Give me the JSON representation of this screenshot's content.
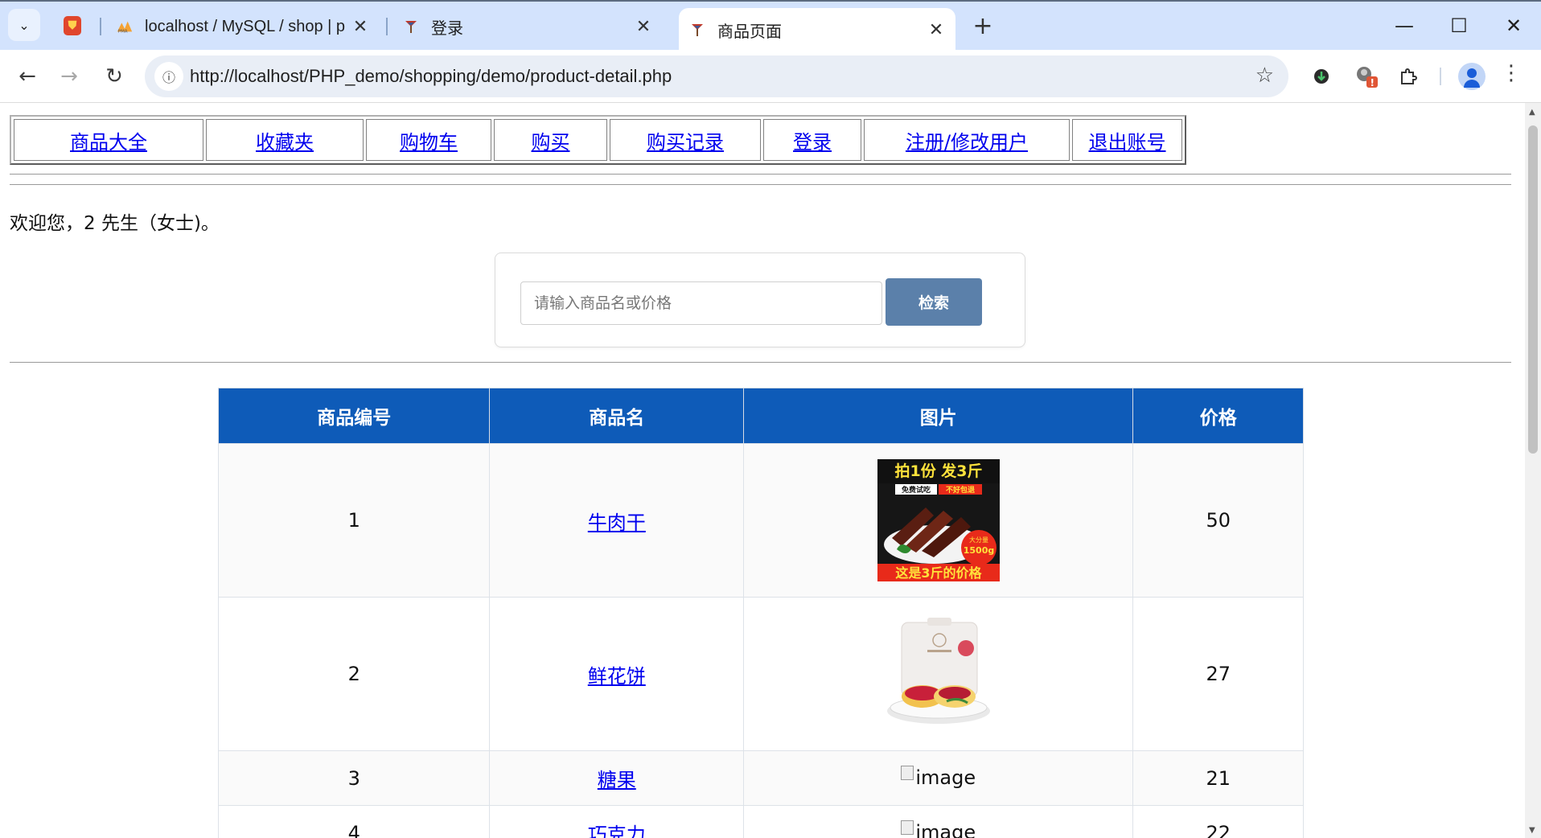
{
  "browser": {
    "tabs": [
      {
        "title": "localhost / MySQL / shop | p",
        "favicon": "phpmyadmin-icon"
      },
      {
        "title": "登录",
        "favicon": "site-icon"
      },
      {
        "title": "商品页面",
        "favicon": "site-icon",
        "active": true
      }
    ],
    "new_tab_label": "+",
    "url": "http://localhost/PHP_demo/shopping/demo/product-detail.php",
    "site_info_symbol": "ⓘ"
  },
  "nav_menu": [
    {
      "label": "商品大全"
    },
    {
      "label": "收藏夹"
    },
    {
      "label": "购物车"
    },
    {
      "label": "购买"
    },
    {
      "label": "购买记录"
    },
    {
      "label": "登录"
    },
    {
      "label": "注册/修改用户"
    },
    {
      "label": "退出账号"
    }
  ],
  "welcome_text": "欢迎您，2 先生（女士)。",
  "search": {
    "placeholder": "请输入商品名或价格",
    "button_label": "检索"
  },
  "products": {
    "columns": [
      "商品编号",
      "商品名",
      "图片",
      "价格"
    ],
    "rows": [
      {
        "id": "1",
        "name": "牛肉干",
        "image": "beef-jerky-image",
        "price": "50",
        "image_text": {
          "top": "拍1份 发3斤",
          "tag1": "免费试吃",
          "tag2": "不好包退",
          "badge1": "大分量",
          "badge2": "1500g",
          "bottom": "这是3斤的价格"
        }
      },
      {
        "id": "2",
        "name": "鲜花饼",
        "image": "flower-cake-image",
        "price": "27"
      },
      {
        "id": "3",
        "name": "糖果",
        "image": "broken-image",
        "image_alt": "image",
        "price": "21"
      },
      {
        "id": "4",
        "name": "巧克力",
        "image": "broken-image",
        "image_alt": "image",
        "price": "22"
      }
    ]
  },
  "colors": {
    "table_header": "#0e5bb8",
    "search_button": "#5b80aa",
    "link": "#0000ee",
    "tabstrip": "#d3e3fd"
  }
}
